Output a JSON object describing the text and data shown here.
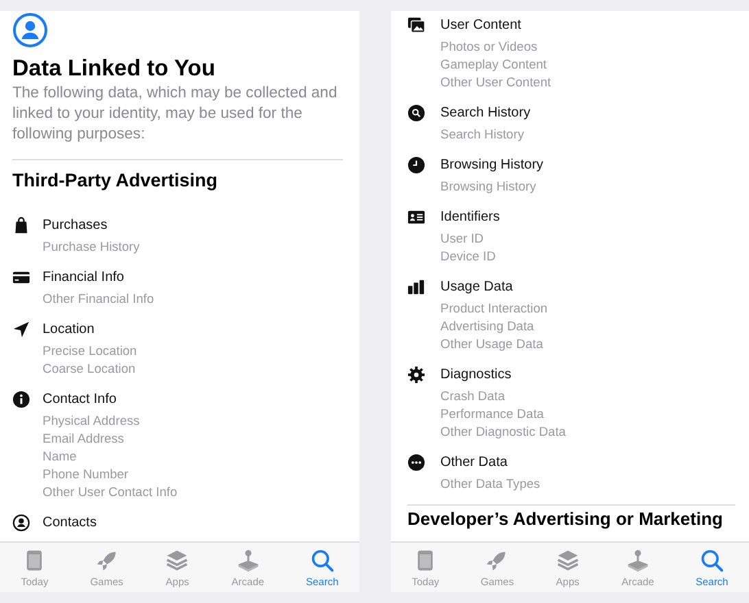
{
  "screens": [
    {
      "header": {
        "title": "Data Linked to You",
        "description": "The following data, which may be collected and linked to your identity, may be used for the following purposes:"
      },
      "section_title": "Third-Party Advertising",
      "categories": [
        {
          "kind": "bag",
          "title": "Purchases",
          "items": [
            "Purchase History"
          ]
        },
        {
          "kind": "card",
          "title": "Financial Info",
          "items": [
            "Other Financial Info"
          ]
        },
        {
          "kind": "location",
          "title": "Location",
          "items": [
            "Precise Location",
            "Coarse Location"
          ]
        },
        {
          "kind": "info",
          "title": "Contact Info",
          "items": [
            "Physical Address",
            "Email Address",
            "Name",
            "Phone Number",
            "Other User Contact Info"
          ]
        },
        {
          "kind": "contacts",
          "title": "Contacts"
        }
      ],
      "tabs": [
        {
          "kind": "today",
          "label": "Today",
          "selected": false
        },
        {
          "kind": "games",
          "label": "Games",
          "selected": false
        },
        {
          "kind": "apps",
          "label": "Apps",
          "selected": false
        },
        {
          "kind": "arcade",
          "label": "Arcade",
          "selected": false
        },
        {
          "kind": "search",
          "label": "Search",
          "selected": true
        }
      ]
    },
    {
      "categories": [
        {
          "kind": "photos",
          "title": "User Content",
          "items": [
            "Photos or Videos",
            "Gameplay Content",
            "Other User Content"
          ]
        },
        {
          "kind": "search",
          "title": "Search History",
          "items": [
            "Search History"
          ]
        },
        {
          "kind": "clock",
          "title": "Browsing History",
          "items": [
            "Browsing History"
          ]
        },
        {
          "kind": "id",
          "title": "Identifiers",
          "items": [
            "User ID",
            "Device ID"
          ]
        },
        {
          "kind": "bars",
          "title": "Usage Data",
          "items": [
            "Product Interaction",
            "Advertising Data",
            "Other Usage Data"
          ]
        },
        {
          "kind": "gear",
          "title": "Diagnostics",
          "items": [
            "Crash Data",
            "Performance Data",
            "Other Diagnostic Data"
          ]
        },
        {
          "kind": "more",
          "title": "Other Data",
          "items": [
            "Other Data Types"
          ]
        }
      ],
      "section_title": "Developer’s Advertising or Marketing",
      "tabs": [
        {
          "kind": "today",
          "label": "Today",
          "selected": false
        },
        {
          "kind": "games",
          "label": "Games",
          "selected": false
        },
        {
          "kind": "apps",
          "label": "Apps",
          "selected": false
        },
        {
          "kind": "arcade",
          "label": "Arcade",
          "selected": false
        },
        {
          "kind": "search",
          "label": "Search",
          "selected": true
        }
      ]
    }
  ]
}
